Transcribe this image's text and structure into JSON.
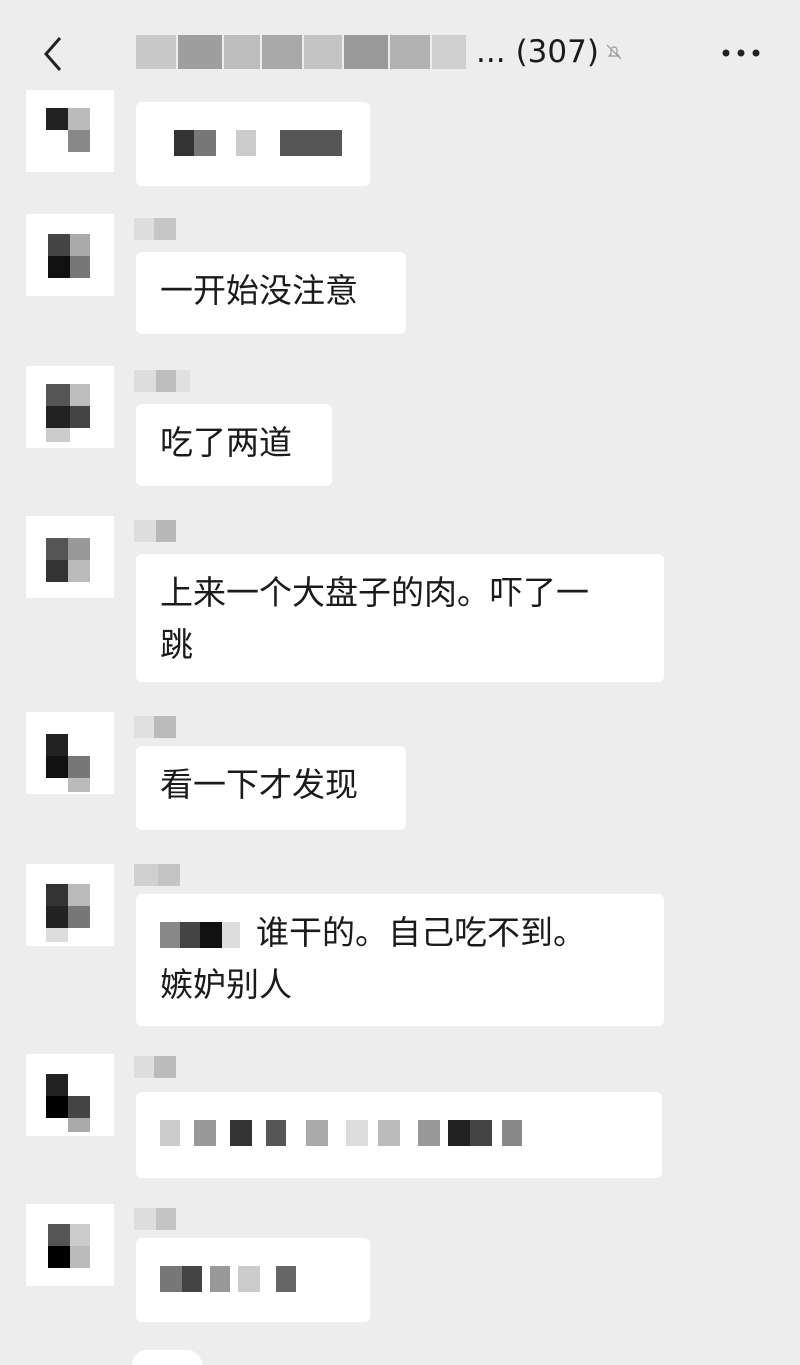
{
  "header": {
    "title_suffix": "...",
    "count": "(307)"
  },
  "messages": [
    {
      "text": ""
    },
    {
      "text": "一开始没注意"
    },
    {
      "text": "吃了两道"
    },
    {
      "line1": "上来一个大盘子的肉。吓了一",
      "line2": "跳"
    },
    {
      "text": "看一下才发现"
    },
    {
      "line1_suffix": "谁干的。自己吃不到。",
      "line2": "嫉妒别人"
    },
    {
      "text": ""
    },
    {
      "text": ""
    }
  ],
  "colors": {
    "background": "#ededed",
    "bubble": "#ffffff",
    "text": "#1b1b1b"
  }
}
